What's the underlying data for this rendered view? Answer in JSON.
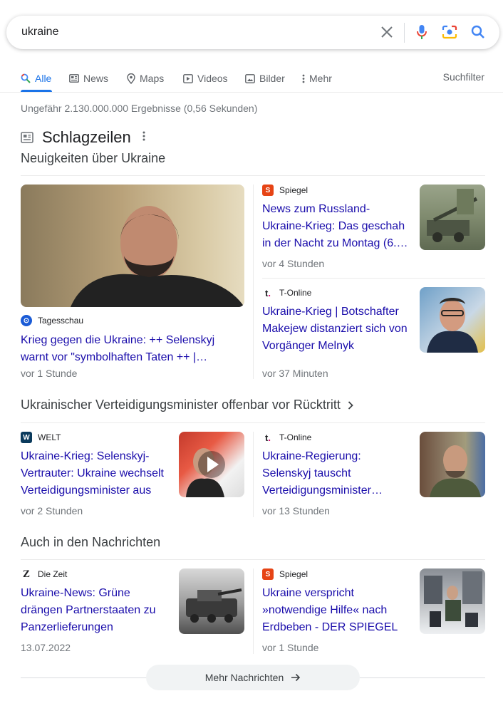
{
  "search": {
    "query": "ukraine"
  },
  "tabs": [
    {
      "label": "Alle"
    },
    {
      "label": "News"
    },
    {
      "label": "Maps"
    },
    {
      "label": "Videos"
    },
    {
      "label": "Bilder"
    },
    {
      "label": "Mehr"
    }
  ],
  "suchfilter": "Suchfilter",
  "stats": "Ungefähr 2.130.000.000 Ergebnisse (0,56 Sekunden)",
  "section": {
    "title": "Schlagzeilen",
    "subtitle": "Neuigkeiten über Ukraine"
  },
  "top_stories": {
    "main": {
      "source": "Tagesschau",
      "headline_l1": "Krieg gegen die Ukraine: ++ Selenskyj",
      "headline_l2": "warnt vor \"symbolhaften Taten ++ |…",
      "age": "vor 1 Stunde"
    },
    "side": [
      {
        "source": "Spiegel",
        "headline_l1": "News zum Russland-",
        "headline_l2": "Ukraine-Krieg: Das geschah",
        "headline_l3": "in der Nacht zu Montag (6.…",
        "age": "vor 4 Stunden"
      },
      {
        "source": "T-Online",
        "headline_l1": "Ukraine-Krieg | Botschafter",
        "headline_l2": "Makejew distanziert sich von",
        "headline_l3": "Vorgänger Melnyk",
        "age": "vor 37 Minuten"
      }
    ]
  },
  "cluster": {
    "title": "Ukrainischer Verteidigungsminister offenbar vor Rücktritt",
    "stories": [
      {
        "source": "WELT",
        "headline_l1": "Ukraine-Krieg: Selenskyj-",
        "headline_l2": "Vertrauter: Ukraine wechselt",
        "headline_l3": "Verteidigungsminister aus",
        "age": "vor 2 Stunden"
      },
      {
        "source": "T-Online",
        "headline_l1": "Ukraine-Regierung:",
        "headline_l2": "Selenskyj tauscht",
        "headline_l3": "Verteidigungsminister…",
        "age": "vor 13 Stunden"
      }
    ]
  },
  "also": {
    "title": "Auch in den Nachrichten",
    "stories": [
      {
        "source": "Die Zeit",
        "headline_l1": "Ukraine-News: Grüne",
        "headline_l2": "drängen Partnerstaaten zu",
        "headline_l3": "Panzerlieferungen",
        "age": "13.07.2022"
      },
      {
        "source": "Spiegel",
        "headline_l1": "Ukraine verspricht",
        "headline_l2": "»notwendige Hilfe« nach",
        "headline_l3": "Erdbeben - DER SPIEGEL",
        "age": "vor 1 Stunde"
      }
    ]
  },
  "more_button": "Mehr Nachrichten",
  "colors": {
    "link": "#1a0dab",
    "accent": "#1a73e8",
    "spiegel": "#e64415",
    "welt": "#0a3a5c",
    "tagesschau": "#1a5bd6",
    "tonline": "#e20074"
  }
}
